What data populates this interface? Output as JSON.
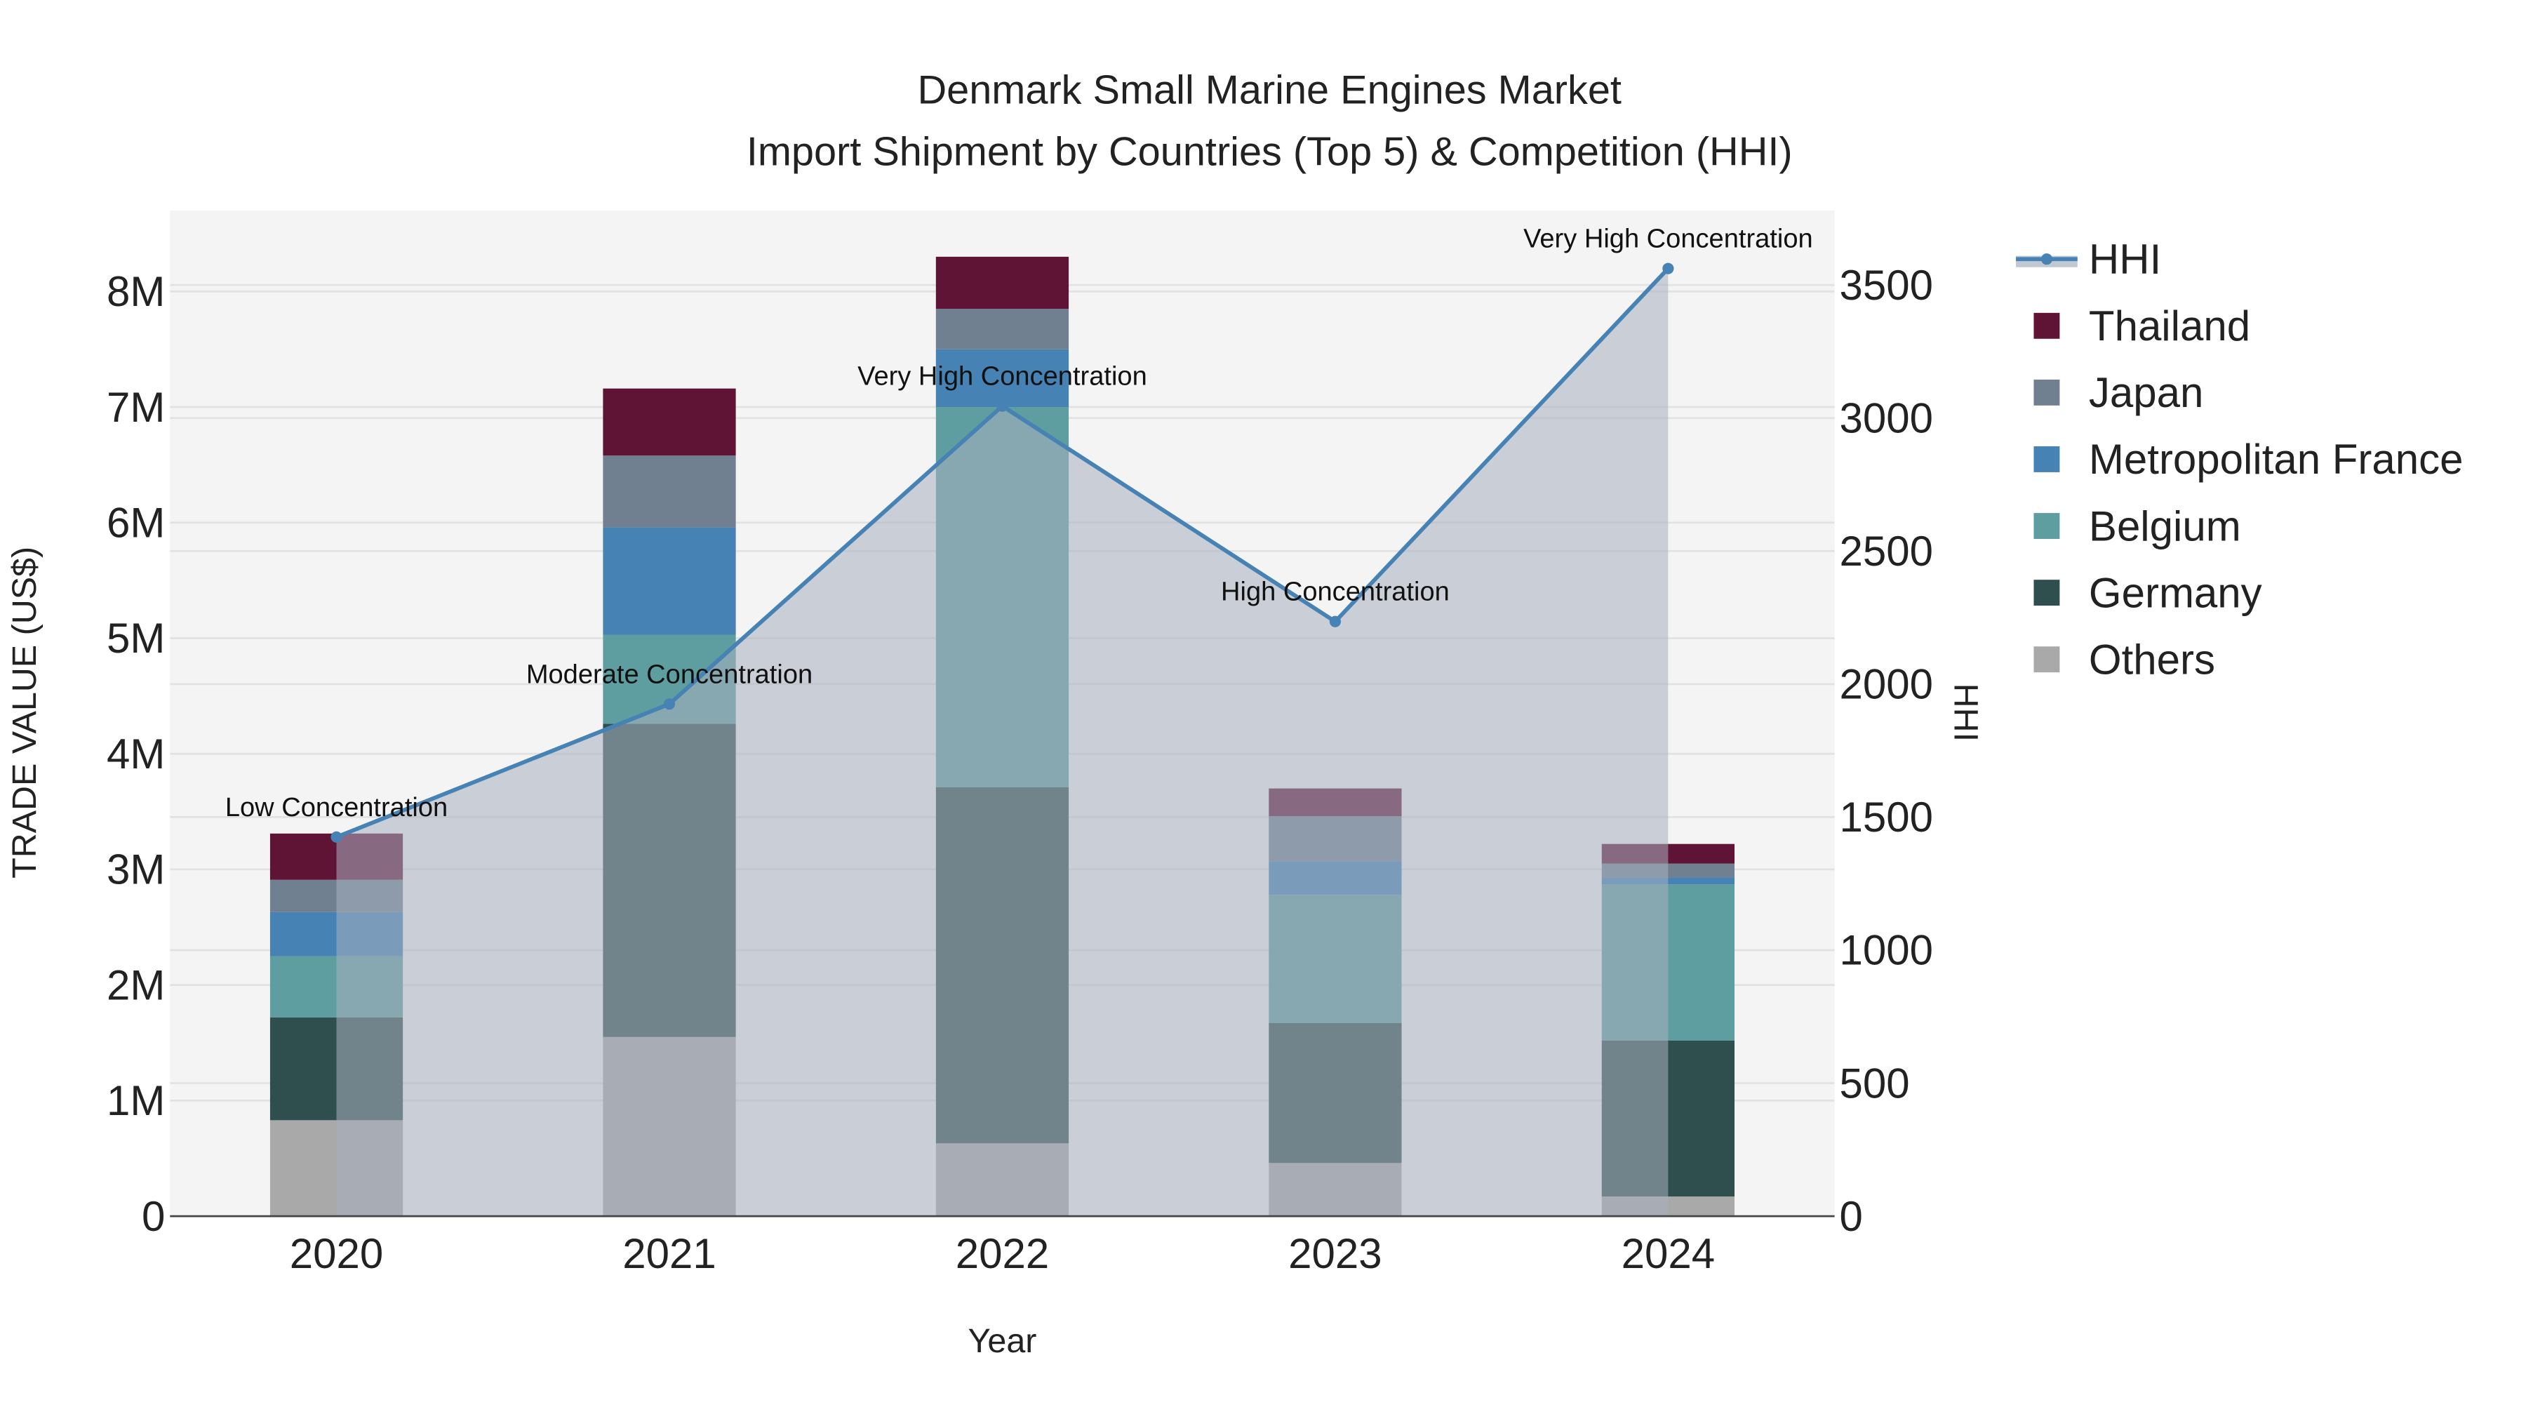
{
  "chart_data": {
    "type": "bar",
    "title": "Denmark Small Marine Engines Market",
    "subtitle": "Import Shipment by Countries (Top 5) & Competition (HHI)",
    "xlabel": "Year",
    "ylabel": "TRADE VALUE (US$)",
    "y2label": "HHI",
    "categories": [
      "2020",
      "2021",
      "2022",
      "2023",
      "2024"
    ],
    "ylim": [
      0,
      8700000
    ],
    "y2lim": [
      0,
      3780
    ],
    "yticks": [
      0,
      1000000,
      2000000,
      3000000,
      4000000,
      5000000,
      6000000,
      7000000,
      8000000
    ],
    "yticklabels": [
      "0",
      "1M",
      "2M",
      "3M",
      "4M",
      "5M",
      "6M",
      "7M",
      "8M"
    ],
    "y2ticks": [
      0,
      500,
      1000,
      1500,
      2000,
      2500,
      3000,
      3500
    ],
    "y2ticklabels": [
      "0",
      "500",
      "1000",
      "1500",
      "2000",
      "2500",
      "3000",
      "3500"
    ],
    "series": [
      {
        "name": "Others",
        "color": "#a9a9a9",
        "values": [
          830000,
          1550000,
          630000,
          460000,
          170000
        ]
      },
      {
        "name": "Germany",
        "color": "#2f4f4f",
        "values": [
          890000,
          2710000,
          3080000,
          1210000,
          1350000
        ]
      },
      {
        "name": "Belgium",
        "color": "#5f9ea0",
        "values": [
          530000,
          770000,
          3290000,
          1110000,
          1350000
        ]
      },
      {
        "name": "Metropolitan France",
        "color": "#4682b4",
        "values": [
          380000,
          930000,
          500000,
          290000,
          60000
        ]
      },
      {
        "name": "Japan",
        "color": "#708090",
        "values": [
          280000,
          620000,
          350000,
          390000,
          120000
        ]
      },
      {
        "name": "Thailand",
        "color": "#5f1436",
        "values": [
          400000,
          580000,
          450000,
          240000,
          170000
        ]
      }
    ],
    "hhi": {
      "name": "HHI",
      "color": "#4682b4",
      "values": [
        1425,
        1925,
        3045,
        2235,
        3562
      ],
      "annotations": [
        "Low Concentration",
        "Moderate Concentration",
        "Very High Concentration",
        "High Concentration",
        "Very High Concentration"
      ]
    },
    "legend": [
      "HHI",
      "Thailand",
      "Japan",
      "Metropolitan France",
      "Belgium",
      "Germany",
      "Others"
    ],
    "legend_position": "right",
    "grid": true
  }
}
